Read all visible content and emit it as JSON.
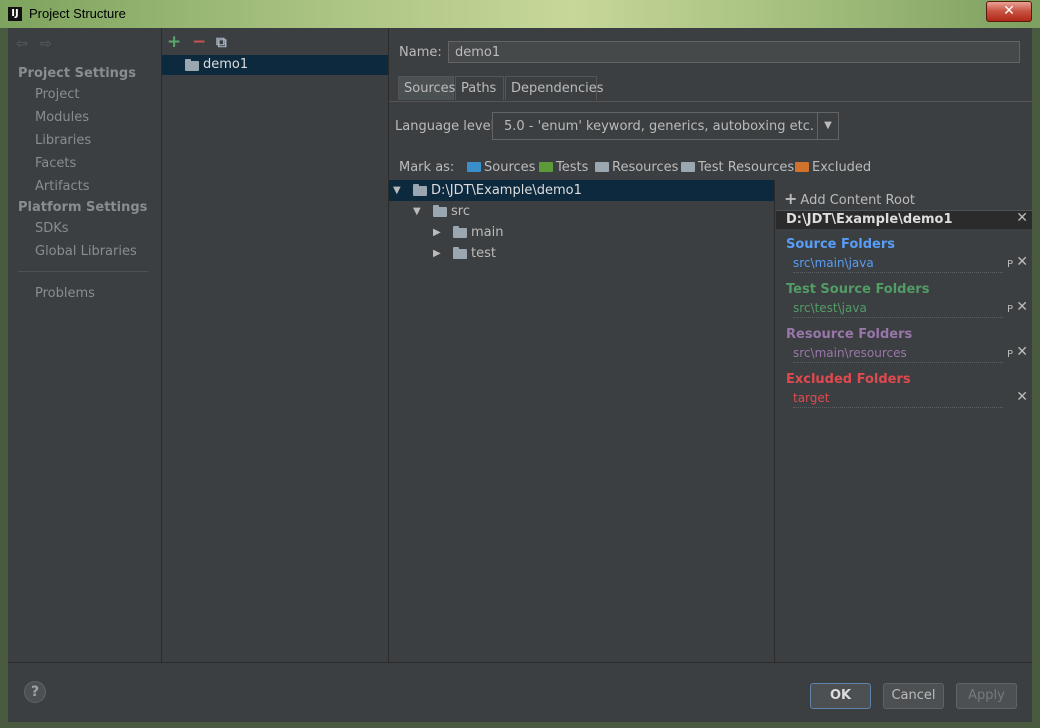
{
  "window": {
    "title": "Project Structure",
    "app_icon": "IJ",
    "close_glyph": "✕"
  },
  "nav": {
    "back_glyph": "⇦",
    "forward_glyph": "⇨",
    "project_settings": "Project Settings",
    "project_items": [
      "Project",
      "Modules",
      "Libraries",
      "Facets",
      "Artifacts"
    ],
    "platform_settings": "Platform Settings",
    "platform_items": [
      "SDKs",
      "Global Libraries"
    ],
    "problems": "Problems"
  },
  "modules": {
    "add_glyph": "+",
    "remove_glyph": "−",
    "copy_glyph": "⧉",
    "items": [
      "demo1"
    ]
  },
  "content": {
    "name_label": "Name:",
    "name_value": "demo1",
    "tabs": [
      "Sources",
      "Paths",
      "Dependencies"
    ],
    "language_label": "Language level:",
    "language_value": "5.0 - 'enum' keyword, generics, autoboxing etc.",
    "mark_label": "Mark as:",
    "mark_items": [
      {
        "label": "Sources",
        "color": "#3a8ec9"
      },
      {
        "label": "Tests",
        "color": "#5d9b3a"
      },
      {
        "label": "Resources",
        "color": "#9aa7b0"
      },
      {
        "label": "Test Resources",
        "color": "#9aa7b0"
      },
      {
        "label": "Excluded",
        "color": "#d0722c"
      }
    ]
  },
  "tree": {
    "root": "D:\\JDT\\Example\\demo1",
    "src": "src",
    "main": "main",
    "test": "test"
  },
  "roots": {
    "add_label": "Add Content Root",
    "root_path": "D:\\JDT\\Example\\demo1",
    "source_heading": "Source Folders",
    "source_entry": "src\\main\\java",
    "test_heading": "Test Source Folders",
    "test_entry": "src\\test\\java",
    "resource_heading": "Resource Folders",
    "resource_entry": "src\\main\\resources",
    "excluded_heading": "Excluded Folders",
    "excluded_entry": "target",
    "edit_glyph": "P",
    "remove_glyph": "✕",
    "colors": {
      "source": "#589df6",
      "test": "#529c66",
      "resource": "#9876aa",
      "excluded": "#e0494e"
    }
  },
  "buttons": {
    "help": "?",
    "ok": "OK",
    "cancel": "Cancel",
    "apply": "Apply"
  }
}
